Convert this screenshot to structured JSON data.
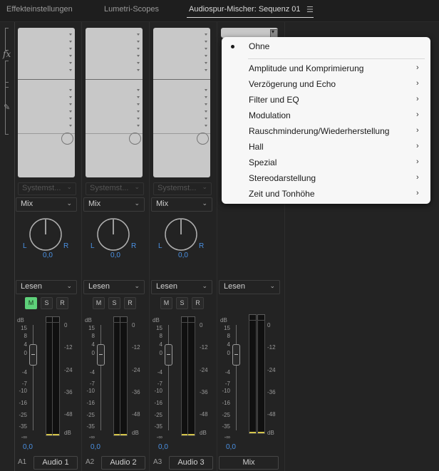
{
  "tabs": [
    {
      "label": "Effekteinstellungen",
      "active": false
    },
    {
      "label": "Lumetri-Scopes",
      "active": false
    },
    {
      "label": "Audiospur-Mischer: Sequenz 01",
      "active": true
    }
  ],
  "tab_menu_icon": "hamburger-menu-icon",
  "left_strip": {
    "fx_label": "fx",
    "send_icon": "send-icon"
  },
  "channels": [
    {
      "id": "A1",
      "name": "Audio 1",
      "send": "Systemst...",
      "output": "Mix",
      "pan": "0,0",
      "pan_left": "L",
      "pan_right": "R",
      "automation": "Lesen",
      "gain": "0,0",
      "mute": "M",
      "solo": "S",
      "record": "R",
      "mute_on": true
    },
    {
      "id": "A2",
      "name": "Audio 2",
      "send": "Systemst...",
      "output": "Mix",
      "pan": "0,0",
      "pan_left": "L",
      "pan_right": "R",
      "automation": "Lesen",
      "gain": "0,0",
      "mute": "M",
      "solo": "S",
      "record": "R",
      "mute_on": false
    },
    {
      "id": "A3",
      "name": "Audio 3",
      "send": "Systemst...",
      "output": "Mix",
      "pan": "0,0",
      "pan_left": "L",
      "pan_right": "R",
      "automation": "Lesen",
      "gain": "0,0",
      "mute": "M",
      "solo": "S",
      "record": "R",
      "mute_on": false
    },
    {
      "id": "",
      "name": "Mix",
      "automation": "Lesen",
      "gain": "0,0"
    }
  ],
  "fader_scale": {
    "unit": "dB",
    "labels": [
      "15",
      "8",
      "4",
      "0",
      "-4",
      "-7",
      "-10",
      "-16",
      "-25",
      "-35",
      "-∞"
    ]
  },
  "meter_scale": {
    "labels": [
      "0",
      "-12",
      "-24",
      "-36",
      "-48"
    ],
    "unit": "dB"
  },
  "effect_menu": {
    "selected": "Ohne",
    "items": [
      {
        "label": "Amplitude und Komprimierung",
        "submenu": true
      },
      {
        "label": "Verzögerung und Echo",
        "submenu": true
      },
      {
        "label": "Filter und EQ",
        "submenu": true
      },
      {
        "label": "Modulation",
        "submenu": true
      },
      {
        "label": "Rauschminderung/Wiederherstellung",
        "submenu": true
      },
      {
        "label": "Hall",
        "submenu": true
      },
      {
        "label": "Spezial",
        "submenu": true
      },
      {
        "label": "Stereodarstellung",
        "submenu": true
      },
      {
        "label": "Zeit und Tonhöhe",
        "submenu": true
      }
    ]
  },
  "colors": {
    "mute_active": "#5ed17a",
    "value_blue": "#4a90e2",
    "meter_floor": "#d4c44a",
    "background": "#232323"
  }
}
